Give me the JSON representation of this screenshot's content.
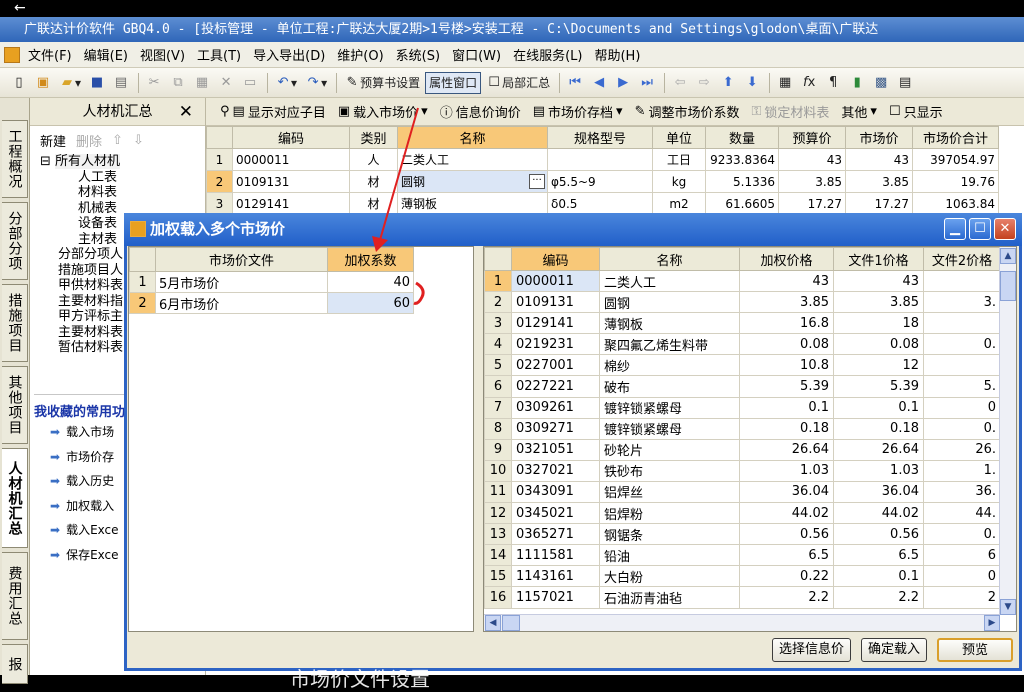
{
  "titlebar": {
    "text": "广联达计价软件 GBQ4.0 - [投标管理 - 单位工程:广联达大厦2期>1号楼>安装工程 - C:\\Documents and Settings\\glodon\\桌面\\广联达"
  },
  "menu": [
    "文件(F)",
    "编辑(E)",
    "视图(V)",
    "工具(T)",
    "导入导出(D)",
    "维护(O)",
    "系统(S)",
    "窗口(W)",
    "在线服务(L)",
    "帮助(H)"
  ],
  "toolbar": {
    "budget_settings": "预算书设置",
    "property_window": "属性窗口",
    "local_summary": "局部汇总"
  },
  "vtabs": [
    "工程概况",
    "分部分项",
    "措施项目",
    "其他项目",
    "人材机汇总",
    "费用汇总",
    "报"
  ],
  "leftpanel": {
    "title": "人材机汇总",
    "close": "✕",
    "new_label": "新建",
    "delete_label": "删除",
    "tree": [
      "所有人材机",
      "人工表",
      "材料表",
      "机械表",
      "设备表",
      "主材表",
      "分部分项人",
      "措施项目人",
      "甲供材料表",
      "主要材料指",
      "甲方评标主",
      "主要材料表",
      "暂估材料表"
    ],
    "favorites_title": "我收藏的常用功",
    "favorites": [
      "载入市场",
      "市场价存",
      "载入历史",
      "加权载入",
      "载入Exce",
      "保存Exce"
    ]
  },
  "main_toolbar": {
    "show_child": "显示对应子目",
    "load_market": "载入市场价",
    "info_price": "信息价询价",
    "market_archive": "市场价存档",
    "adjust_coef": "调整市场价系数",
    "lock_material": "锁定材料表",
    "other": "其他",
    "only_show": "只显示"
  },
  "main_table": {
    "headers": [
      "编码",
      "类别",
      "名称",
      "规格型号",
      "单位",
      "数量",
      "预算价",
      "市场价",
      "市场价合计"
    ],
    "rows": [
      {
        "n": "1",
        "code": "0000011",
        "cat": "人",
        "name": "二类人工",
        "spec": "",
        "unit": "工日",
        "qty": "9233.8364",
        "budget": "43",
        "market": "43",
        "total": "397054.97"
      },
      {
        "n": "2",
        "code": "0109131",
        "cat": "材",
        "name": "圆钢",
        "spec": "φ5.5~9",
        "unit": "kg",
        "qty": "5.1336",
        "budget": "3.85",
        "market": "3.85",
        "total": "19.76"
      },
      {
        "n": "3",
        "code": "0129141",
        "cat": "材",
        "name": "薄钢板",
        "spec": "δ0.5",
        "unit": "m2",
        "qty": "61.6605",
        "budget": "17.27",
        "market": "17.27",
        "total": "1063.84"
      }
    ]
  },
  "dialog": {
    "title": "加权载入多个市场价",
    "left_headers": [
      "市场价文件",
      "加权系数"
    ],
    "left_rows": [
      {
        "n": "1",
        "file": "5月市场价",
        "coef": "40"
      },
      {
        "n": "2",
        "file": "6月市场价",
        "coef": "60"
      }
    ],
    "right_headers": [
      "编码",
      "名称",
      "加权价格",
      "文件1价格",
      "文件2价格"
    ],
    "right_rows": [
      {
        "n": "1",
        "code": "0000011",
        "name": "二类人工",
        "w": "43",
        "f1": "43",
        "f2": ""
      },
      {
        "n": "2",
        "code": "0109131",
        "name": "圆钢",
        "w": "3.85",
        "f1": "3.85",
        "f2": "3."
      },
      {
        "n": "3",
        "code": "0129141",
        "name": "薄钢板",
        "w": "16.8",
        "f1": "18",
        "f2": ""
      },
      {
        "n": "4",
        "code": "0219231",
        "name": "聚四氟乙烯生料带",
        "w": "0.08",
        "f1": "0.08",
        "f2": "0."
      },
      {
        "n": "5",
        "code": "0227001",
        "name": "棉纱",
        "w": "10.8",
        "f1": "12",
        "f2": ""
      },
      {
        "n": "6",
        "code": "0227221",
        "name": "破布",
        "w": "5.39",
        "f1": "5.39",
        "f2": "5."
      },
      {
        "n": "7",
        "code": "0309261",
        "name": "镀锌锁紧螺母",
        "w": "0.1",
        "f1": "0.1",
        "f2": "0"
      },
      {
        "n": "8",
        "code": "0309271",
        "name": "镀锌锁紧螺母",
        "w": "0.18",
        "f1": "0.18",
        "f2": "0."
      },
      {
        "n": "9",
        "code": "0321051",
        "name": "砂轮片",
        "w": "26.64",
        "f1": "26.64",
        "f2": "26."
      },
      {
        "n": "10",
        "code": "0327021",
        "name": "铁砂布",
        "w": "1.03",
        "f1": "1.03",
        "f2": "1."
      },
      {
        "n": "11",
        "code": "0343091",
        "name": "铝焊丝",
        "w": "36.04",
        "f1": "36.04",
        "f2": "36."
      },
      {
        "n": "12",
        "code": "0345021",
        "name": "铝焊粉",
        "w": "44.02",
        "f1": "44.02",
        "f2": "44."
      },
      {
        "n": "13",
        "code": "0365271",
        "name": "钢锯条",
        "w": "0.56",
        "f1": "0.56",
        "f2": "0."
      },
      {
        "n": "14",
        "code": "1111581",
        "name": "铅油",
        "w": "6.5",
        "f1": "6.5",
        "f2": "6"
      },
      {
        "n": "15",
        "code": "1143161",
        "name": "大白粉",
        "w": "0.22",
        "f1": "0.1",
        "f2": "0"
      },
      {
        "n": "16",
        "code": "1157021",
        "name": "石油沥青油毡",
        "w": "2.2",
        "f1": "2.2",
        "f2": "2"
      }
    ],
    "btn_select_info": "选择信息价",
    "btn_confirm": "确定载入",
    "btn_preview": "预览"
  },
  "subtitle": "市场价文件设置"
}
